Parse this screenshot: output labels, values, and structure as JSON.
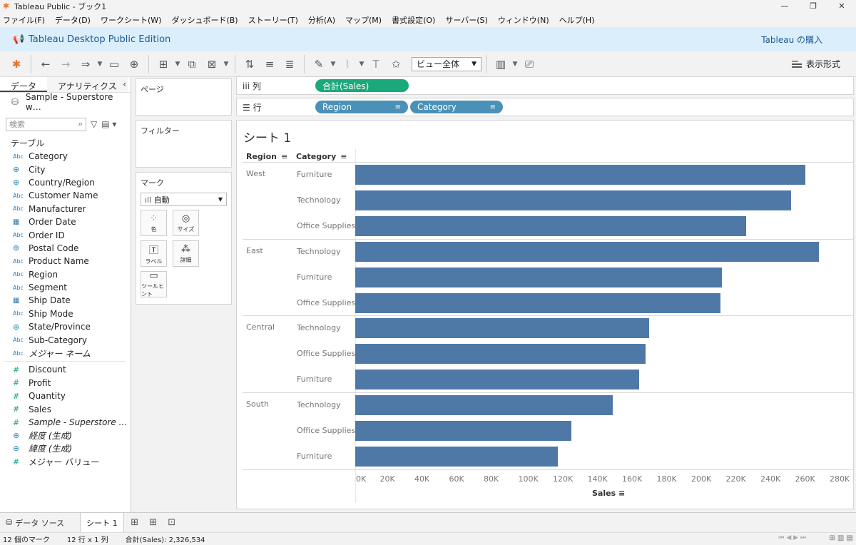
{
  "window": {
    "title": "Tableau Public - ブック1",
    "controls": [
      "—",
      "❐",
      "✕"
    ]
  },
  "menu": [
    "ファイル(F)",
    "データ(D)",
    "ワークシート(W)",
    "ダッシュボード(B)",
    "ストーリー(T)",
    "分析(A)",
    "マップ(M)",
    "書式設定(O)",
    "サーバー(S)",
    "ウィンドウ(N)",
    "ヘルプ(H)"
  ],
  "banner": {
    "edition": "Tableau Desktop Public Edition",
    "buy": "Tableau の購入"
  },
  "toolbar": {
    "fit_value": "ビュー全体",
    "show_me": "表示形式"
  },
  "data_pane": {
    "tab_data": "データ",
    "tab_analytics": "アナリティクス",
    "datasource": "Sample - Superstore w…",
    "search_placeholder": "検索",
    "section_title": "テーブル",
    "dimensions": [
      {
        "type": "abc",
        "name": "Category"
      },
      {
        "type": "geo",
        "name": "City"
      },
      {
        "type": "geo",
        "name": "Country/Region"
      },
      {
        "type": "abc",
        "name": "Customer Name"
      },
      {
        "type": "abc",
        "name": "Manufacturer"
      },
      {
        "type": "date",
        "name": "Order Date"
      },
      {
        "type": "abc",
        "name": "Order ID"
      },
      {
        "type": "geo",
        "name": "Postal Code"
      },
      {
        "type": "abc",
        "name": "Product Name"
      },
      {
        "type": "abc",
        "name": "Region"
      },
      {
        "type": "abc",
        "name": "Segment"
      },
      {
        "type": "date",
        "name": "Ship Date"
      },
      {
        "type": "abc",
        "name": "Ship Mode"
      },
      {
        "type": "geo",
        "name": "State/Province"
      },
      {
        "type": "abc",
        "name": "Sub-Category"
      },
      {
        "type": "abc",
        "name": "メジャー ネーム",
        "italic": true
      }
    ],
    "measures": [
      {
        "type": "num",
        "name": "Discount"
      },
      {
        "type": "num",
        "name": "Profit"
      },
      {
        "type": "num",
        "name": "Quantity"
      },
      {
        "type": "num",
        "name": "Sales"
      },
      {
        "type": "num",
        "name": "Sample - Superstore wit…",
        "italic": true
      },
      {
        "type": "geo",
        "name": "経度 (生成)",
        "italic": true
      },
      {
        "type": "geo",
        "name": "緯度 (生成)",
        "italic": true
      },
      {
        "type": "num",
        "name": "メジャー バリュー"
      }
    ]
  },
  "cards": {
    "pages": "ページ",
    "filters": "フィルター",
    "marks": "マーク",
    "mark_type": "自動",
    "mark_buttons": [
      {
        "icon": "color-icon",
        "label": "色"
      },
      {
        "icon": "size-icon",
        "label": "サイズ"
      },
      {
        "icon": "label-icon",
        "label": "ラベル"
      },
      {
        "icon": "detail-icon",
        "label": "詳細"
      },
      {
        "icon": "tooltip-icon",
        "label": "ツールヒント"
      }
    ]
  },
  "shelves": {
    "columns_label": "列",
    "rows_label": "行",
    "columns_pills": [
      "合計(Sales)"
    ],
    "rows_pills": [
      "Region",
      "Category"
    ]
  },
  "view": {
    "sheet_title": "シート 1",
    "region_header": "Region",
    "category_header": "Category"
  },
  "chart_data": {
    "type": "bar",
    "orientation": "horizontal",
    "title": "シート 1",
    "xlabel": "Sales",
    "row_headers": [
      "Region",
      "Category"
    ],
    "xlim": [
      0,
      280000
    ],
    "x_ticks": [
      "0K",
      "20K",
      "40K",
      "60K",
      "80K",
      "100K",
      "120K",
      "140K",
      "160K",
      "180K",
      "200K",
      "220K",
      "240K",
      "260K",
      "280K"
    ],
    "groups": [
      {
        "region": "West",
        "rows": [
          {
            "category": "Furniture",
            "value": 260000
          },
          {
            "category": "Technology",
            "value": 252000
          },
          {
            "category": "Office Supplies",
            "value": 226000
          }
        ]
      },
      {
        "region": "East",
        "rows": [
          {
            "category": "Technology",
            "value": 268000
          },
          {
            "category": "Furniture",
            "value": 212000
          },
          {
            "category": "Office Supplies",
            "value": 211000
          }
        ]
      },
      {
        "region": "Central",
        "rows": [
          {
            "category": "Technology",
            "value": 170000
          },
          {
            "category": "Office Supplies",
            "value": 168000
          },
          {
            "category": "Furniture",
            "value": 164000
          }
        ]
      },
      {
        "region": "South",
        "rows": [
          {
            "category": "Technology",
            "value": 149000
          },
          {
            "category": "Office Supplies",
            "value": 125000
          },
          {
            "category": "Furniture",
            "value": 117000
          }
        ]
      }
    ],
    "bar_color": "#4e79a7",
    "grid": false
  },
  "sheet_tabs": {
    "datasource": "データ ソース",
    "sheet": "シート 1"
  },
  "status": {
    "marks": "12 個のマーク",
    "rows_cols": "12 行 x 1 列",
    "sum": "合計(Sales): 2,326,534"
  }
}
